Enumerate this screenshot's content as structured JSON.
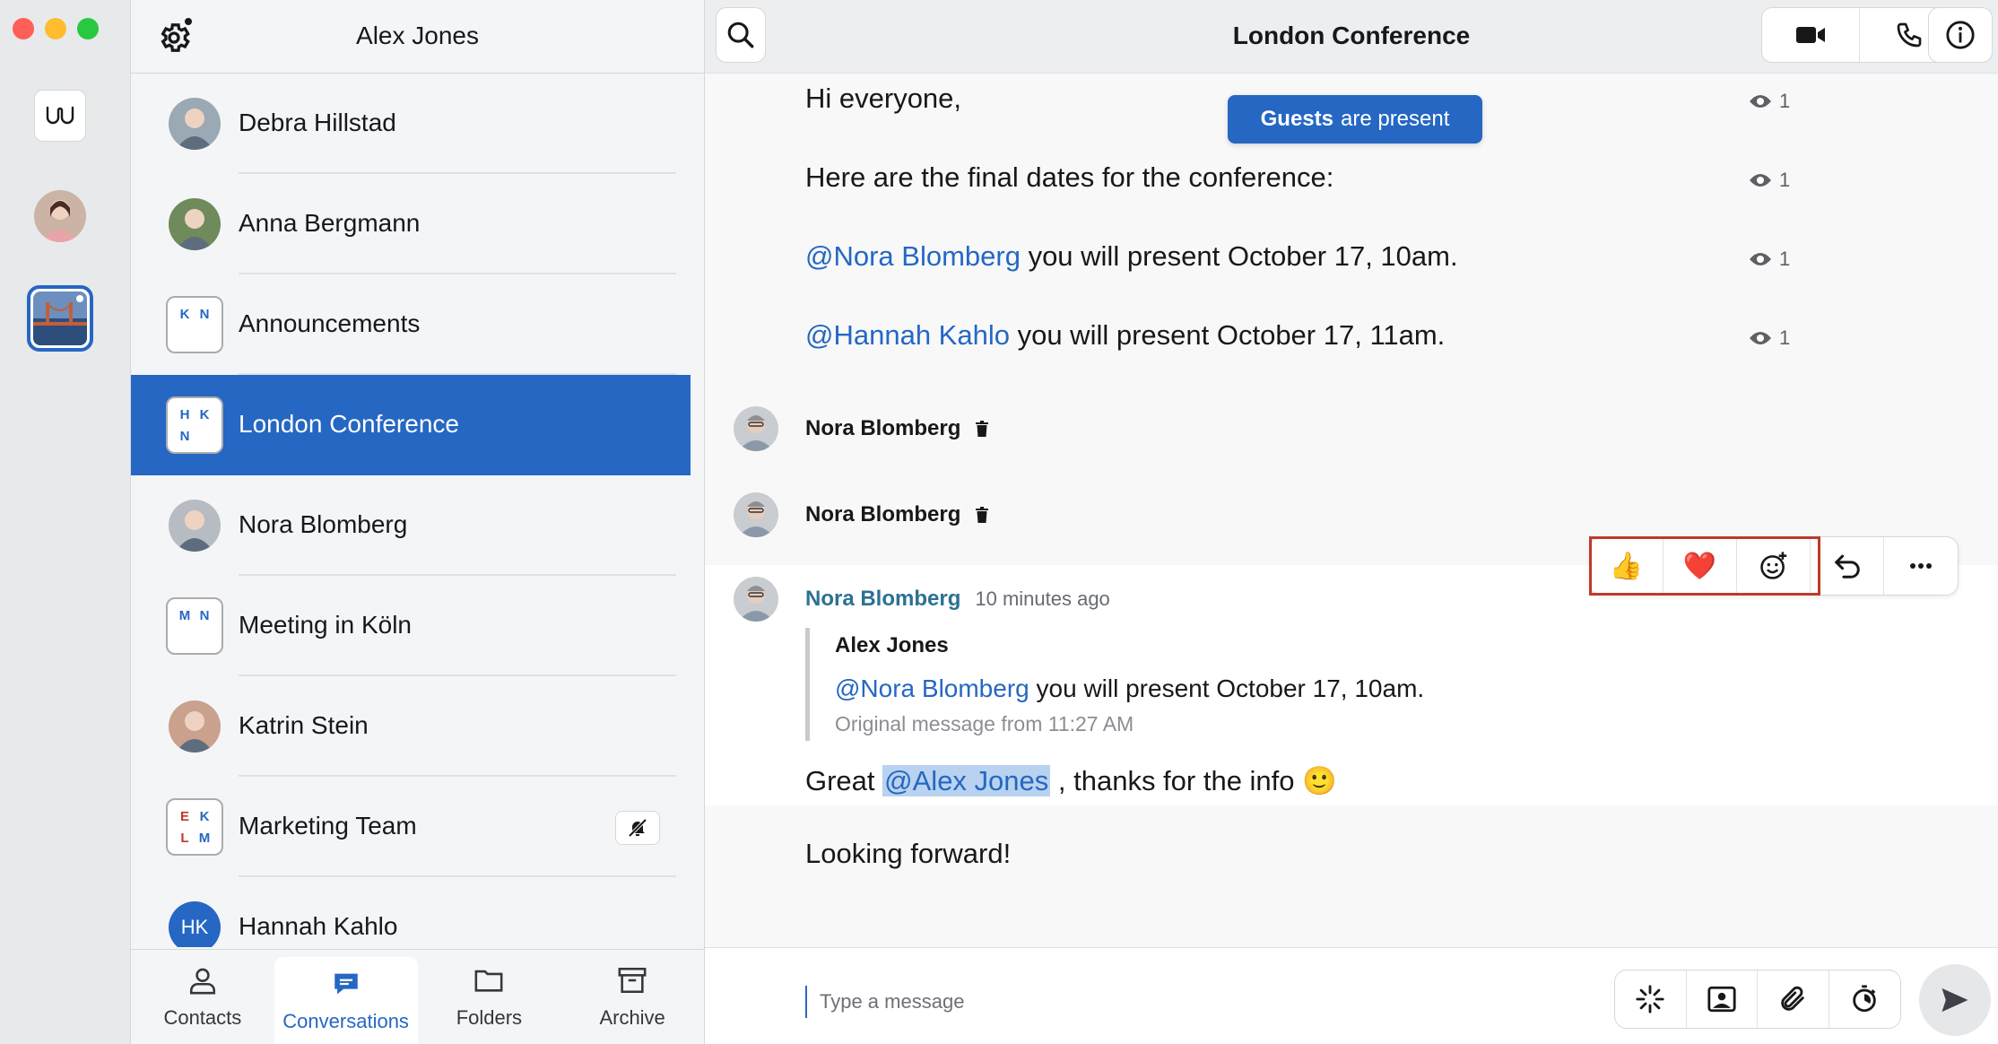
{
  "app": {
    "user_name": "Alex Jones"
  },
  "conversations": [
    {
      "label": "Debra Hillstad",
      "type": "person",
      "color": "#9aa9b4"
    },
    {
      "label": "Anna Bergmann",
      "type": "person",
      "color": "#6f8b5b"
    },
    {
      "label": "Announcements",
      "type": "group",
      "initials": [
        "K",
        "N",
        "",
        ""
      ],
      "initial_colors": [
        "#2567c3",
        "#2567c3",
        "",
        ""
      ]
    },
    {
      "label": "London Conference",
      "type": "group",
      "initials": [
        "H",
        "K",
        "N",
        ""
      ],
      "initial_colors": [
        "#2567c3",
        "#2567c3",
        "#2567c3",
        ""
      ]
    },
    {
      "label": "Nora Blomberg",
      "type": "person",
      "color": "#b7bcc2"
    },
    {
      "label": "Meeting in Köln",
      "type": "group",
      "initials": [
        "M",
        "N",
        "",
        ""
      ],
      "initial_colors": [
        "#2567c3",
        "#2567c3",
        "",
        ""
      ]
    },
    {
      "label": "Katrin Stein",
      "type": "person",
      "color": "#c9a18d"
    },
    {
      "label": "Marketing Team",
      "type": "group",
      "initials": [
        "E",
        "K",
        "L",
        "M"
      ],
      "initial_colors": [
        "#c0392b",
        "#2567c3",
        "#c0392b",
        "#2567c3"
      ]
    },
    {
      "label": "Hannah Kahlo",
      "type": "initials",
      "initials_text": "HK"
    }
  ],
  "active_conversation_index": 3,
  "bottom_nav": [
    {
      "label": "Contacts",
      "icon": "person-icon"
    },
    {
      "label": "Conversations",
      "icon": "chat-bubble-icon"
    },
    {
      "label": "Folders",
      "icon": "folder-icon"
    },
    {
      "label": "Archive",
      "icon": "archive-icon"
    }
  ],
  "main": {
    "title": "London Conference",
    "guests_banner": {
      "bold": "Guests",
      "rest": "are present"
    },
    "messages": [
      {
        "text": "Hi everyone,",
        "seen": "1"
      },
      {
        "text": "Here are the final dates for the conference:",
        "seen": "1"
      },
      {
        "mention": "@Nora Blomberg",
        "text": " you will present October 17, 10am.",
        "seen": "1"
      },
      {
        "mention": "@Hannah Kahlo",
        "text": " you will present October 17, 11am.",
        "seen": "1"
      }
    ],
    "deleted_rows": [
      {
        "name": "Nora Blomberg"
      },
      {
        "name": "Nora Blomberg"
      }
    ],
    "reply": {
      "author": "Nora Blomberg",
      "time": "10 minutes ago",
      "quote_author": "Alex Jones",
      "quote_mention": "@Nora Blomberg",
      "quote_text": " you will present October 17, 10am.",
      "quote_meta": "Original message from 11:27 AM",
      "text_before": "Great ",
      "text_mention": "@Alex Jones",
      "text_after": " , thanks for the info ",
      "emoji": "🙂",
      "followup": "Looking forward!"
    },
    "message_actions": {
      "thumbs_up": "👍",
      "heart": "❤️"
    },
    "composer_placeholder": "Type a message"
  },
  "colors": {
    "accent": "#2567c3",
    "highlight_outline": "#c0392b"
  }
}
